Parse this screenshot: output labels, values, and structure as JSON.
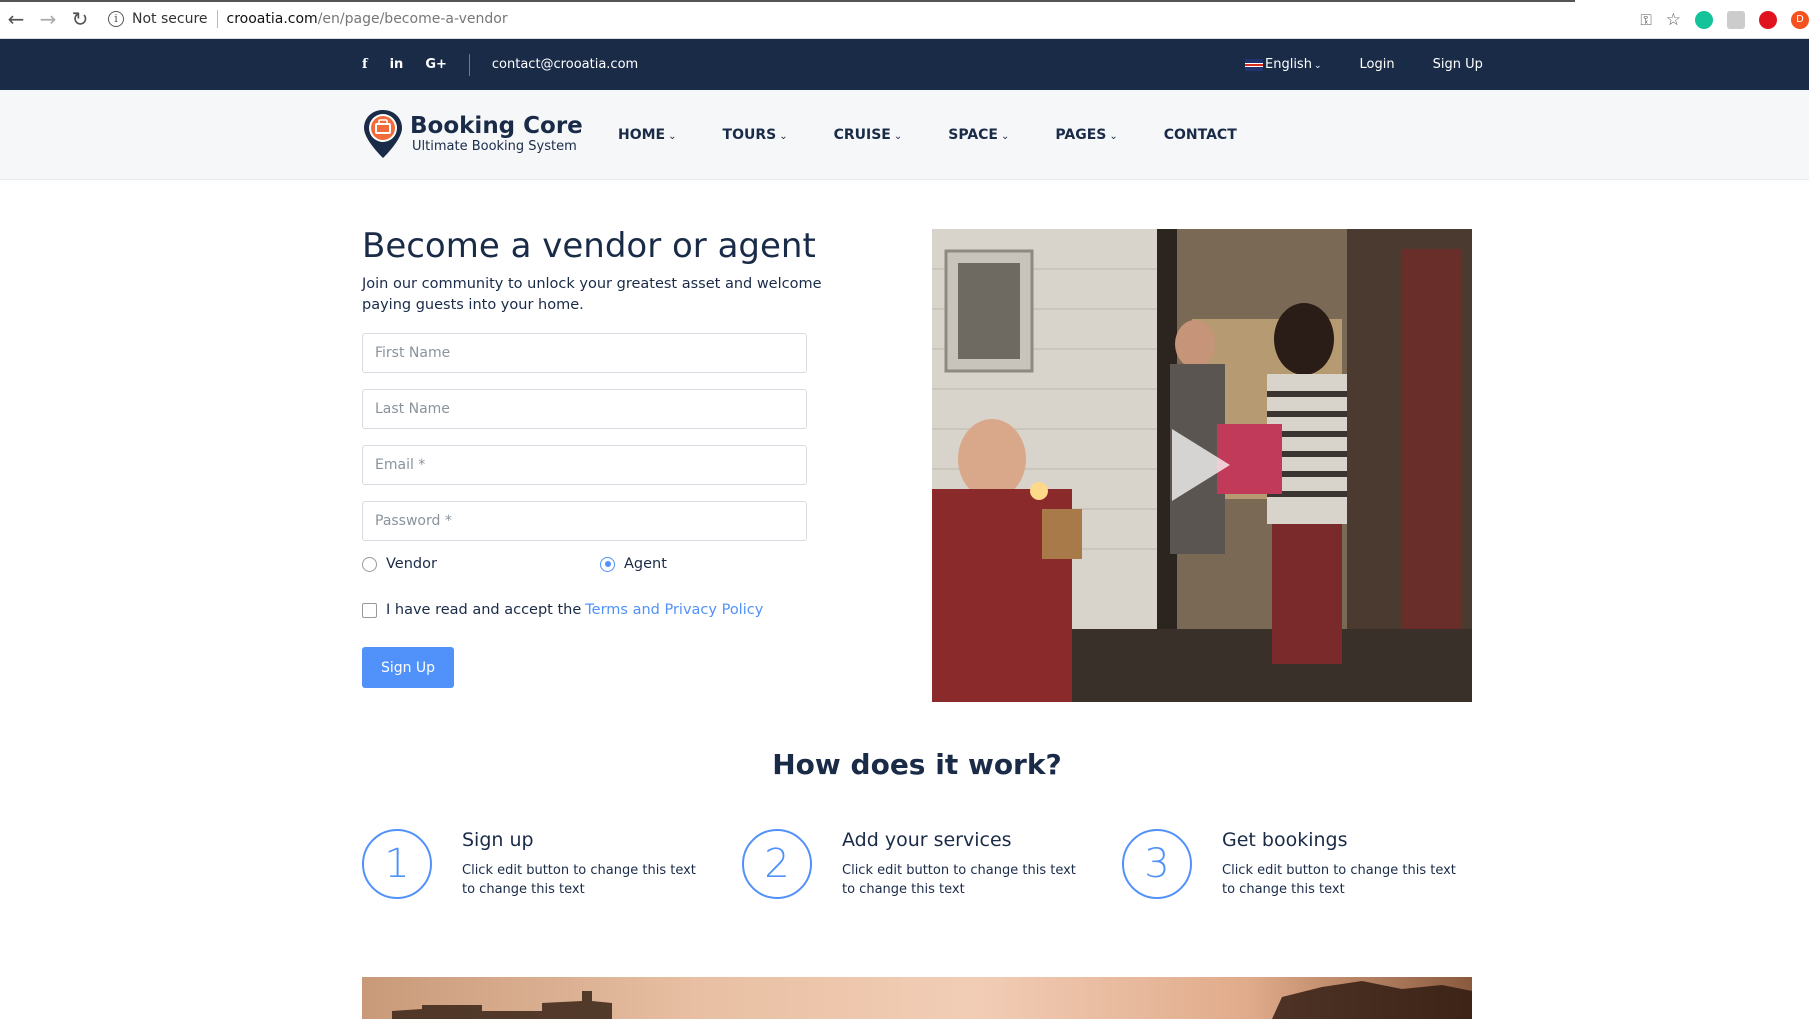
{
  "browser": {
    "security_label": "Not secure",
    "url_host": "crooatia.com",
    "url_path": "/en/page/become-a-vendor",
    "profile_initial": "D"
  },
  "topbar": {
    "email": "contact@crooatia.com",
    "language": "English",
    "login": "Login",
    "signup": "Sign Up"
  },
  "header": {
    "brand_title": "Booking Core",
    "brand_tagline": "Ultimate Booking System",
    "menu": [
      {
        "label": "HOME",
        "has_dropdown": true
      },
      {
        "label": "TOURS",
        "has_dropdown": true
      },
      {
        "label": "CRUISE",
        "has_dropdown": true
      },
      {
        "label": "SPACE",
        "has_dropdown": true
      },
      {
        "label": "PAGES",
        "has_dropdown": true
      },
      {
        "label": "CONTACT",
        "has_dropdown": false
      }
    ]
  },
  "form": {
    "title": "Become a vendor or agent",
    "subtitle": "Join our community to unlock your greatest asset and welcome paying guests into your home.",
    "first_name_placeholder": "First Name",
    "last_name_placeholder": "Last Name",
    "email_placeholder": "Email *",
    "password_placeholder": "Password *",
    "role_vendor": "Vendor",
    "role_agent": "Agent",
    "selected_role": "Agent",
    "terms_text": "I have read and accept the",
    "terms_link": "Terms and Privacy Policy",
    "submit_label": "Sign Up"
  },
  "how": {
    "title": "How does it work?",
    "steps": [
      {
        "number": "1",
        "title": "Sign up",
        "desc": "Click edit button to change this text to change this text"
      },
      {
        "number": "2",
        "title": "Add your services",
        "desc": "Click edit button to change this text to change this text"
      },
      {
        "number": "3",
        "title": "Get bookings",
        "desc": "Click edit button to change this text to change this text"
      }
    ]
  },
  "colors": {
    "navy": "#1a2b48",
    "accent": "#5191fa",
    "header_bg": "#f5f7f9"
  }
}
